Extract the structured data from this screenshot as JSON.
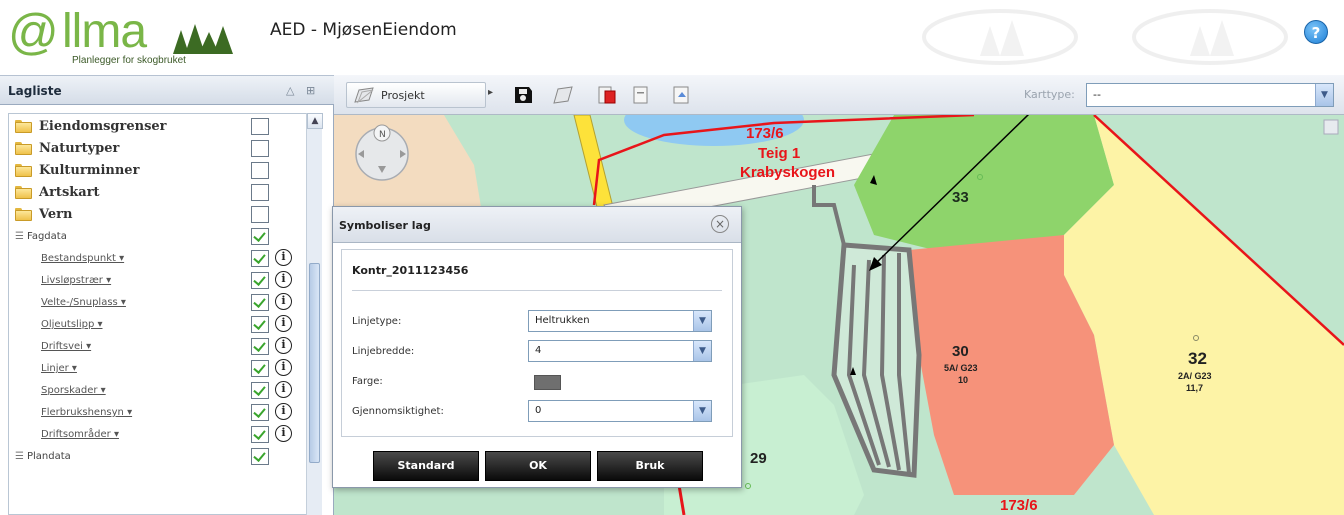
{
  "header": {
    "logo_at": "@",
    "logo_name": "llma",
    "logo_subtitle": "Planlegger for skogbruket",
    "app_title": "AED - MjøsenEiendom",
    "help_label": "?"
  },
  "sidebar": {
    "title": "Lagliste",
    "folders": [
      {
        "label": "Eiendomsgrenser",
        "checked": false
      },
      {
        "label": "Naturtyper",
        "checked": false
      },
      {
        "label": "Kulturminner",
        "checked": false
      },
      {
        "label": "Artskart",
        "checked": false
      },
      {
        "label": "Vern",
        "checked": false
      }
    ],
    "fagdata_label": "Fagdata",
    "fagdata_items": [
      {
        "label": "Bestandspunkt ▾"
      },
      {
        "label": "Livsløpstrær ▾"
      },
      {
        "label": "Velte-/Snuplass ▾"
      },
      {
        "label": "Oljeutslipp ▾"
      },
      {
        "label": "Driftsvei ▾"
      },
      {
        "label": "Linjer ▾"
      },
      {
        "label": "Sporskader ▾"
      },
      {
        "label": "Flerbrukshensyn ▾"
      },
      {
        "label": "Driftsområder ▾"
      }
    ],
    "plandata_label": "Plandata"
  },
  "toolbar": {
    "prosjekt_label": "Prosjekt",
    "karttype_label": "Karttype:",
    "karttype_value": "--"
  },
  "map": {
    "labels": {
      "teig_number": "173/6",
      "teig_name": "Teig 1",
      "teig_place": "Krabyskogen",
      "stand_33": "33",
      "stand_30": "30",
      "stand_30_class": "5A/ G23",
      "stand_30_value": "10",
      "stand_32": "32",
      "stand_32_class": "2A/ G23",
      "stand_32_value": "11,7",
      "stand_29": "29",
      "bottom_teig": "173/6"
    },
    "colors": {
      "grass": "#bfe5cc",
      "field_green": "#8ed46b",
      "salmon": "#f6927a",
      "yellow": "#fdf3a6",
      "boundary_red": "#e8151a"
    }
  },
  "dialog": {
    "title": "Symboliser lag",
    "layer_name": "Kontr_2011123456",
    "fields": {
      "linjetype_label": "Linjetype:",
      "linjetype_value": "Heltrukken",
      "linjebredde_label": "Linjebredde:",
      "linjebredde_value": "4",
      "farge_label": "Farge:",
      "farge_value": "#6f6f6f",
      "gjennomsiktighet_label": "Gjennomsiktighet:",
      "gjennomsiktighet_value": "0"
    },
    "buttons": {
      "standard": "Standard",
      "ok": "OK",
      "bruk": "Bruk"
    }
  }
}
